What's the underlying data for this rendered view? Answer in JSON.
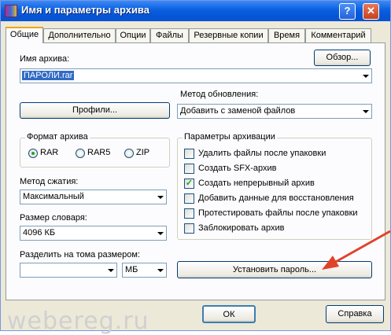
{
  "window": {
    "title": "Имя и параметры архива",
    "help_glyph": "?",
    "close_glyph": "✕"
  },
  "tabs": [
    "Общие",
    "Дополнительно",
    "Опции",
    "Файлы",
    "Резервные копии",
    "Время",
    "Комментарий"
  ],
  "archive": {
    "label": "Имя архива:",
    "value": "ПАРОЛИ.rar",
    "browse": "Обзор..."
  },
  "profiles_button": "Профили...",
  "update_method": {
    "label": "Метод обновления:",
    "value": "Добавить с заменой файлов"
  },
  "format": {
    "title": "Формат архива",
    "options": [
      "RAR",
      "RAR5",
      "ZIP"
    ],
    "selected": "RAR"
  },
  "compression": {
    "label": "Метод сжатия:",
    "value": "Максимальный"
  },
  "dictionary": {
    "label": "Размер словаря:",
    "value": "4096 КБ"
  },
  "split": {
    "label": "Разделить на тома размером:",
    "value": "",
    "unit": "МБ"
  },
  "options": {
    "title": "Параметры архивации",
    "items": [
      {
        "label": "Удалить файлы после упаковки",
        "checked": false
      },
      {
        "label": "Создать SFX-архив",
        "checked": false
      },
      {
        "label": "Создать непрерывный архив",
        "checked": true
      },
      {
        "label": "Добавить данные для восстановления",
        "checked": false
      },
      {
        "label": "Протестировать файлы после упаковки",
        "checked": false
      },
      {
        "label": "Заблокировать архив",
        "checked": false
      }
    ]
  },
  "set_password_button": "Установить пароль...",
  "footer": {
    "ok": "ОК",
    "help": "Справка"
  },
  "watermark": "webereg.ru",
  "colors": {
    "arrow": "#e0432a",
    "titlebar": "#0a5fe0",
    "selection": "#316ac5"
  }
}
